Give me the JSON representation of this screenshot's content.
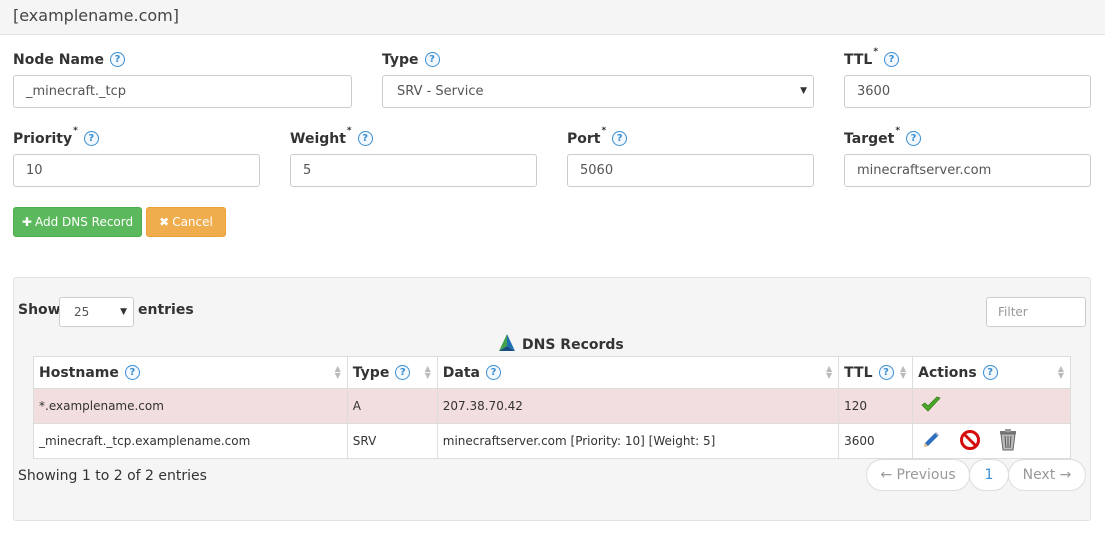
{
  "header": {
    "title": "[examplename.com]"
  },
  "form": {
    "node_name": {
      "label": "Node Name",
      "value": "_minecraft._tcp"
    },
    "type": {
      "label": "Type",
      "value": "SRV - Service"
    },
    "ttl": {
      "label": "TTL",
      "required_mark": "*",
      "value": "3600"
    },
    "priority": {
      "label": "Priority",
      "required_mark": "*",
      "value": "10"
    },
    "weight": {
      "label": "Weight",
      "required_mark": "*",
      "value": "5"
    },
    "port": {
      "label": "Port",
      "required_mark": "*",
      "value": "5060"
    },
    "target": {
      "label": "Target",
      "required_mark": "*",
      "value": "minecraftserver.com"
    },
    "help_glyph": "?",
    "add_button": {
      "icon": "plus-icon",
      "glyph": "✚",
      "label": "Add DNS Record"
    },
    "cancel_button": {
      "icon": "times-icon",
      "glyph": "✖",
      "label": "Cancel"
    }
  },
  "table_controls": {
    "show_label": "Show",
    "page_length": "25",
    "entries_label": "entries",
    "filter_placeholder": "Filter"
  },
  "table": {
    "title": "DNS Records",
    "columns": [
      {
        "label": "Hostname",
        "help": true
      },
      {
        "label": "Type",
        "help": true
      },
      {
        "label": "Data",
        "help": true
      },
      {
        "label": "TTL",
        "help": true
      },
      {
        "label": "Actions",
        "help": true
      }
    ],
    "rows": [
      {
        "hostname": "*.examplename.com",
        "type": "A",
        "data": "207.38.70.42",
        "ttl": "120",
        "actions": [
          "checkmark-icon"
        ],
        "highlight": true
      },
      {
        "hostname": "_minecraft._tcp.examplename.com",
        "type": "SRV",
        "data": "minecraftserver.com [Priority: 10] [Weight: 5]",
        "ttl": "3600",
        "actions": [
          "pencil-icon",
          "ban-icon",
          "trash-icon"
        ],
        "highlight": false
      }
    ]
  },
  "footer": {
    "info": "Showing 1 to 2 of 2 entries",
    "prev_label": "← Previous",
    "current_page": "1",
    "next_label": "Next →"
  },
  "colors": {
    "success": "#5cb85c",
    "warning": "#f0ad4e",
    "help": "#3a8ed3",
    "row_highlight": "#f2dede"
  }
}
